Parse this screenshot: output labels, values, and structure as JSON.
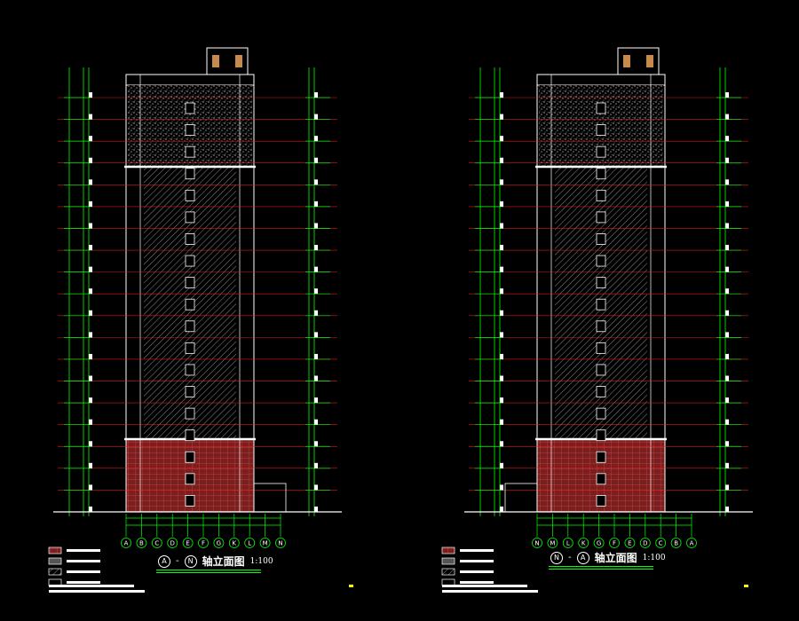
{
  "left_elevation": {
    "title": {
      "axis_start": "A",
      "separator": "-",
      "axis_end": "N",
      "text": "轴立面图",
      "scale": "1:100"
    },
    "grid_axes": [
      "A",
      "B",
      "C",
      "D",
      "E",
      "F",
      "G",
      "K",
      "L",
      "M",
      "N"
    ]
  },
  "right_elevation": {
    "title": {
      "axis_start": "N",
      "separator": "-",
      "axis_end": "A",
      "text": "轴立面图",
      "scale": "1:100"
    },
    "grid_axes": [
      "N",
      "M",
      "L",
      "K",
      "G",
      "F",
      "E",
      "D",
      "C",
      "B",
      "A"
    ]
  },
  "colors": {
    "background": "#000000",
    "line": "#ffffff",
    "dimension": "#00ff00",
    "floor_line": "#ff2020",
    "base_brick": "#b03030",
    "hatch": "#9a9a9a",
    "marker": "#ffff00"
  },
  "legend_swatches": [
    "brick-red",
    "stone-grey",
    "hatch-grey",
    "plain"
  ]
}
